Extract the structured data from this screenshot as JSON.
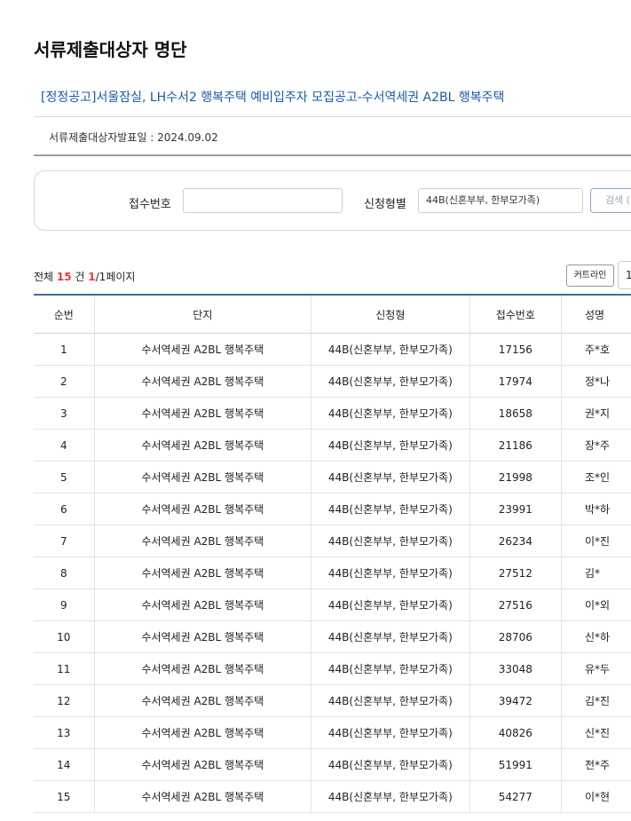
{
  "header": {
    "title": "서류제출대상자 명단",
    "notice_title": "[정정공고]서울잠실, LH수서2 행복주택 예비입주자 모집공고-수서역세권 A2BL 행복주택",
    "announce_date": "서류제출대상자발표일 : 2024.09.02"
  },
  "search": {
    "receipt_label": "접수번호",
    "receipt_value": "",
    "type_label": "신청형별",
    "type_value": "44B(신혼부부, 한부모가족)",
    "button_label": "검색 ("
  },
  "summary": {
    "prefix": "전체 ",
    "total": "15",
    "unit": " 건  ",
    "page_current": "1",
    "page_suffix": "/1페이지"
  },
  "toolbar": {
    "curtain_label": "커트라인",
    "page_size": "1"
  },
  "table": {
    "headers": [
      "순번",
      "단지",
      "신청형",
      "접수번호",
      "성명"
    ],
    "rows": [
      [
        "1",
        "수서역세권 A2BL 행복주택",
        "44B(신혼부부, 한부모가족)",
        "17156",
        "주*호"
      ],
      [
        "2",
        "수서역세권 A2BL 행복주택",
        "44B(신혼부부, 한부모가족)",
        "17974",
        "정*나"
      ],
      [
        "3",
        "수서역세권 A2BL 행복주택",
        "44B(신혼부부, 한부모가족)",
        "18658",
        "권*지"
      ],
      [
        "4",
        "수서역세권 A2BL 행복주택",
        "44B(신혼부부, 한부모가족)",
        "21186",
        "장*주"
      ],
      [
        "5",
        "수서역세권 A2BL 행복주택",
        "44B(신혼부부, 한부모가족)",
        "21998",
        "조*인"
      ],
      [
        "6",
        "수서역세권 A2BL 행복주택",
        "44B(신혼부부, 한부모가족)",
        "23991",
        "박*하"
      ],
      [
        "7",
        "수서역세권 A2BL 행복주택",
        "44B(신혼부부, 한부모가족)",
        "26234",
        "이*진"
      ],
      [
        "8",
        "수서역세권 A2BL 행복주택",
        "44B(신혼부부, 한부모가족)",
        "27512",
        "김*"
      ],
      [
        "9",
        "수서역세권 A2BL 행복주택",
        "44B(신혼부부, 한부모가족)",
        "27516",
        "이*외"
      ],
      [
        "10",
        "수서역세권 A2BL 행복주택",
        "44B(신혼부부, 한부모가족)",
        "28706",
        "신*하"
      ],
      [
        "11",
        "수서역세권 A2BL 행복주택",
        "44B(신혼부부, 한부모가족)",
        "33048",
        "유*두"
      ],
      [
        "12",
        "수서역세권 A2BL 행복주택",
        "44B(신혼부부, 한부모가족)",
        "39472",
        "김*진"
      ],
      [
        "13",
        "수서역세권 A2BL 행복주택",
        "44B(신혼부부, 한부모가족)",
        "40826",
        "신*진"
      ],
      [
        "14",
        "수서역세권 A2BL 행복주택",
        "44B(신혼부부, 한부모가족)",
        "51991",
        "전*주"
      ],
      [
        "15",
        "수서역세권 A2BL 행복주택",
        "44B(신혼부부, 한부모가족)",
        "54277",
        "이*현"
      ]
    ]
  }
}
